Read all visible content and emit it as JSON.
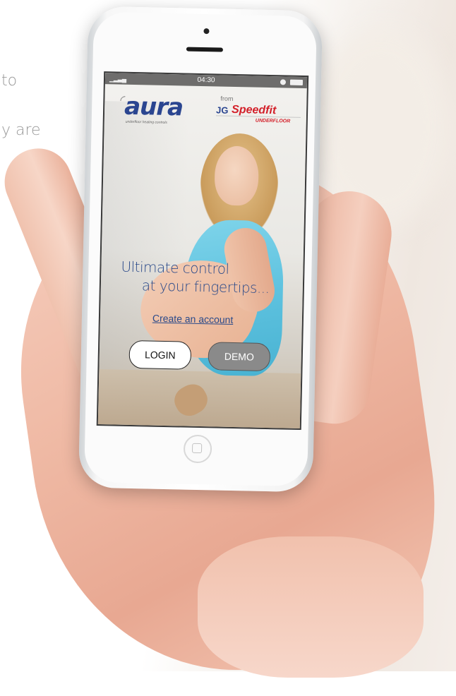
{
  "background_text": {
    "line1": "to",
    "line2": "y are"
  },
  "status_bar": {
    "time": "04:30"
  },
  "branding": {
    "aura_name": "aura",
    "aura_tagline": "underfloor heating controls",
    "from_label": "from",
    "partner_mark": "JG",
    "partner_name": "Speedfit",
    "partner_sub": "UNDERFLOOR"
  },
  "hero": {
    "line1": "Ultimate control",
    "line2": "at your fingertips..."
  },
  "actions": {
    "create_account": "Create an account",
    "login": "LOGIN",
    "demo": "DEMO"
  },
  "colors": {
    "brand_blue": "#2b4a8a",
    "partner_red": "#d3202a",
    "demo_button": "#8a8a8a"
  },
  "icons": [
    "signal-icon",
    "lock-icon",
    "battery-icon",
    "camera-icon",
    "speaker-icon",
    "home-button-icon"
  ]
}
